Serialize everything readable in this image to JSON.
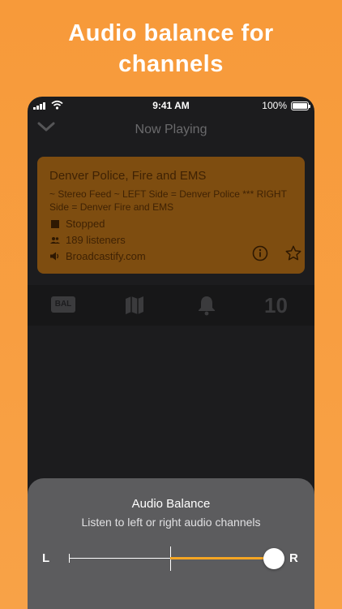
{
  "headline": {
    "line1": "Audio balance for",
    "line2": "channels"
  },
  "status_bar": {
    "time": "9:41 AM",
    "battery_percent": "100%"
  },
  "nav": {
    "title": "Now Playing",
    "back_icon": "chevron-down-icon"
  },
  "station": {
    "name": "Denver Police, Fire and EMS",
    "description": "~ Stereo Feed ~ LEFT Side = Denver Police *** RIGHT Side = Denver Fire and EMS",
    "status": "Stopped",
    "listeners": "189 listeners",
    "source": "Broadcastify.com"
  },
  "toolbar": {
    "balance_label": "BAL",
    "timer_value": "10"
  },
  "balance_sheet": {
    "title": "Audio Balance",
    "subtitle": "Listen to left or right audio channels",
    "left_label": "L",
    "right_label": "R",
    "balance_value": 1.0
  },
  "colors": {
    "background": "#f79a3a",
    "card": "#7e4d10",
    "accent": "#f5a623",
    "sheet": "#5c5c5e",
    "phone": "#1c1c1e"
  }
}
